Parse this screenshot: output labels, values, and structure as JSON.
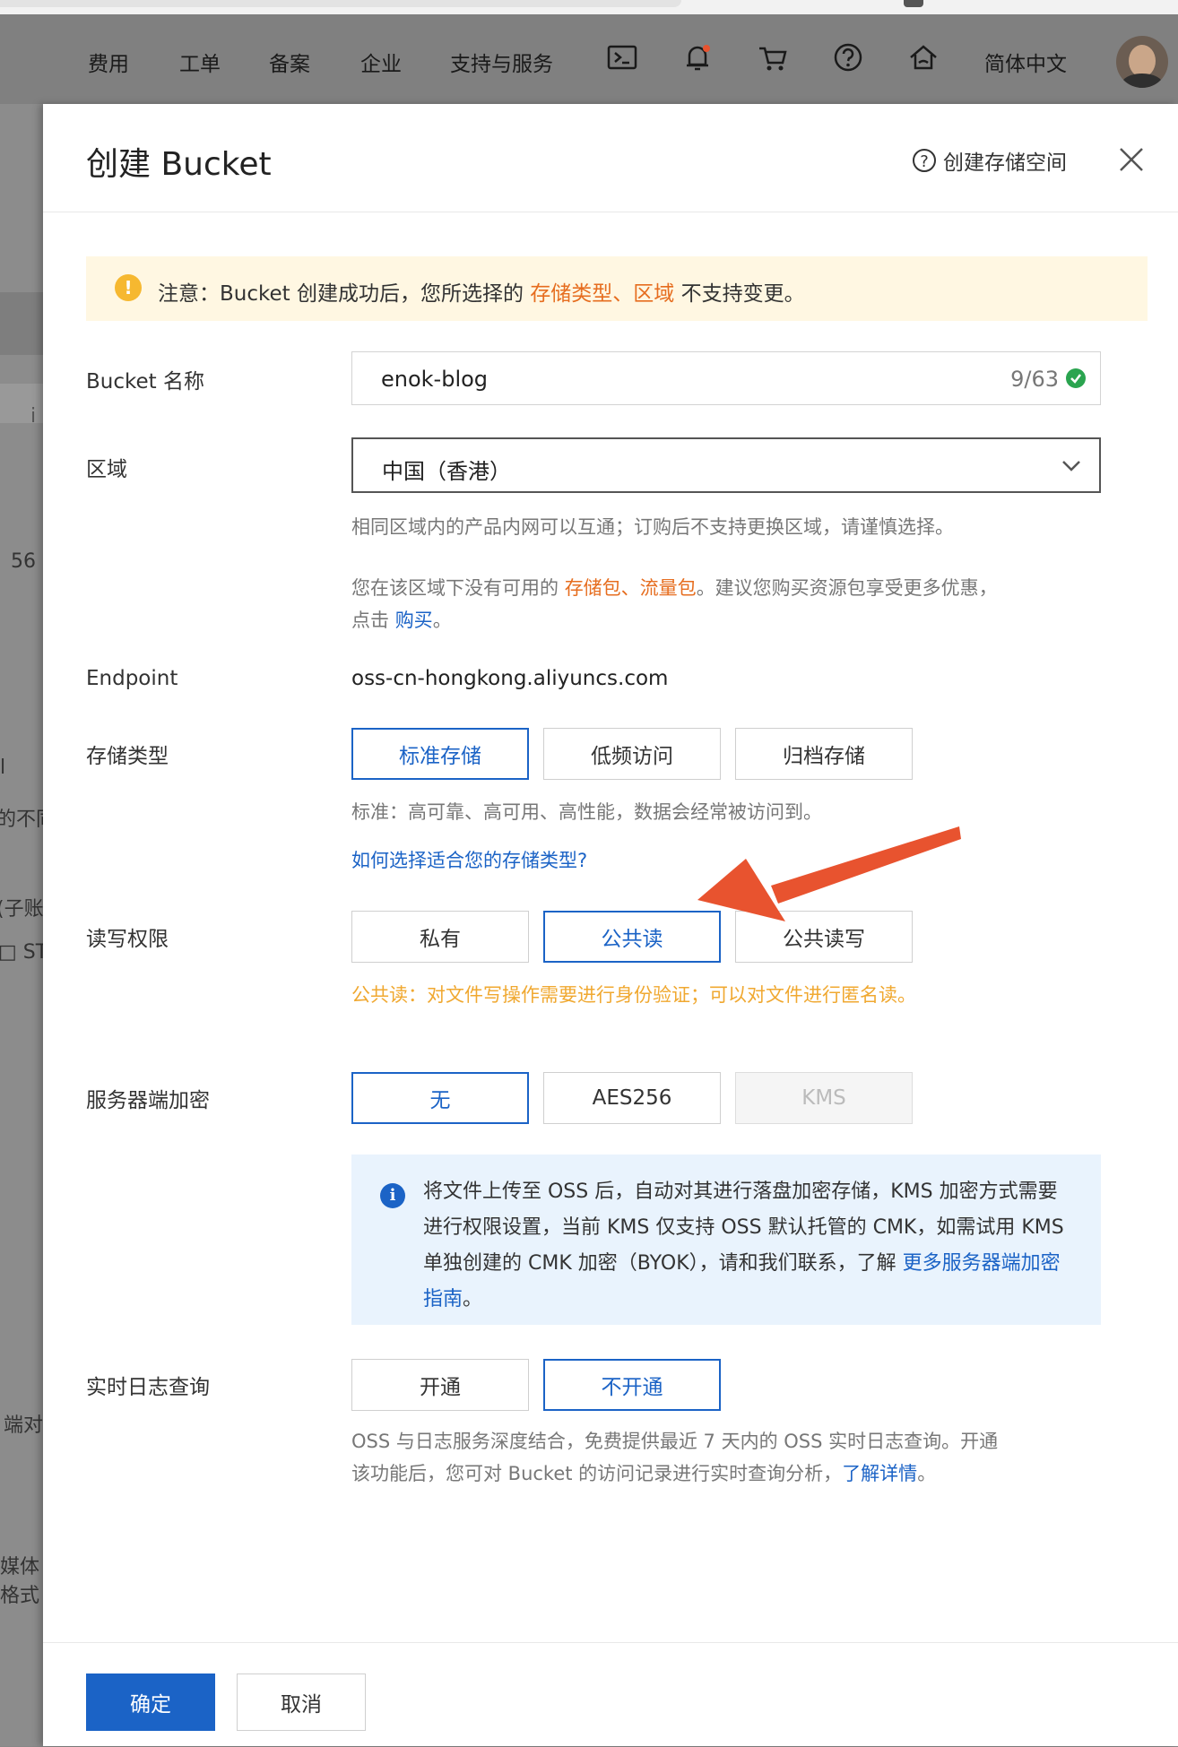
{
  "nav": {
    "items": [
      "费用",
      "工单",
      "备案",
      "企业",
      "支持与服务",
      "简体中文"
    ],
    "icons": [
      "terminal-icon",
      "bell-icon",
      "cart-icon",
      "help-icon",
      "home-icon"
    ]
  },
  "background": {
    "fragments": [
      "i",
      "56",
      "l",
      "的不同",
      "(子账",
      "□ ST",
      "端对",
      "媒体",
      "格式"
    ]
  },
  "panel": {
    "title": "创建 Bucket",
    "help_link": "创建存储空间",
    "help_glyph": "?"
  },
  "notice": {
    "prefix": "注意：Bucket 创建成功后，您所选择的 ",
    "storage_type": "存储类型",
    "sep": "、",
    "region": "区域",
    "suffix": " 不支持变更。"
  },
  "form": {
    "bucket_name": {
      "label": "Bucket 名称",
      "value": "enok-blog",
      "count": "9/63"
    },
    "region": {
      "label": "区域",
      "value": "中国（香港）",
      "hint1": "相同区域内的产品内网可以互通；订购后不支持更换区域，请谨慎选择。",
      "hint2_prefix": "您在该区域下没有可用的 ",
      "hint2_links": "存储包、流量包",
      "hint2_suffix": "。建议您购买资源包享受更多优惠，",
      "hint3_prefix": "点击 ",
      "hint3_link": "购买",
      "hint3_suffix": "。"
    },
    "endpoint": {
      "label": "Endpoint",
      "value": "oss-cn-hongkong.aliyuncs.com"
    },
    "storage_class": {
      "label": "存储类型",
      "options": [
        "标准存储",
        "低频访问",
        "归档存储"
      ],
      "selected": "标准存储",
      "hint": "标准：高可靠、高可用、高性能，数据会经常被访问到。",
      "link": "如何选择适合您的存储类型?"
    },
    "acl": {
      "label": "读写权限",
      "options": [
        "私有",
        "公共读",
        "公共读写"
      ],
      "selected": "公共读",
      "hint": "公共读：对文件写操作需要进行身份验证；可以对文件进行匿名读。"
    },
    "encryption": {
      "label": "服务器端加密",
      "options": [
        "无",
        "AES256",
        "KMS"
      ],
      "selected": "无",
      "disabled": "KMS",
      "info": "将文件上传至 OSS 后，自动对其进行落盘加密存储，KMS 加密方式需要进行权限设置，当前 KMS 仅支持 OSS 默认托管的 CMK，如需试用 KMS 单独创建的 CMK 加密（BYOK），请和我们联系，了解 ",
      "info_link": "更多服务器端加密指南",
      "info_suffix": "。",
      "info_glyph": "i"
    },
    "realtime_log": {
      "label": "实时日志查询",
      "options": [
        "开通",
        "不开通"
      ],
      "selected": "不开通",
      "hint1": "OSS 与日志服务深度结合，免费提供最近 7 天内的 OSS 实时日志查询。开通",
      "hint2_prefix": "该功能后，您可对 Bucket 的访问记录进行实时查询分析，",
      "hint2_link": "了解详情",
      "hint2_suffix": "。"
    }
  },
  "footer": {
    "confirm": "确定",
    "cancel": "取消"
  },
  "colors": {
    "accent": "#1b63c6",
    "warning": "#e66d1f",
    "acl_hint": "#f0a830",
    "arrow": "#e8532f"
  }
}
